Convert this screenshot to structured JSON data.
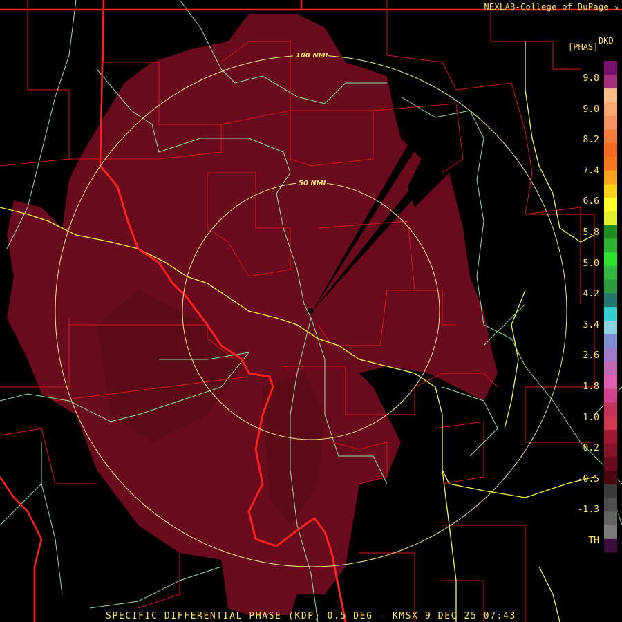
{
  "header": {
    "credit": "NEXLAB-College of DuPage",
    "credit_icon": "external-link-icon"
  },
  "legend": {
    "product_code": "DKD",
    "units": "[PHAS]",
    "labels": [
      "9.8",
      "9.0",
      "8.2",
      "7.4",
      "6.6",
      "5.8",
      "5.0",
      "4.2",
      "3.4",
      "2.6",
      "1.8",
      "1.0",
      "0.2",
      "-0.5",
      "-1.3",
      "TH"
    ],
    "colors": [
      "#7a0e6e",
      "#a52c7e",
      "#f7bd86",
      "#f9a870",
      "#f79360",
      "#f47d3a",
      "#f26b1e",
      "#f47a1c",
      "#f7a51a",
      "#f9d21a",
      "#ffff2e",
      "#e2f02a",
      "#1d8c1e",
      "#2bb42d",
      "#2ce32b",
      "#2fb93e",
      "#2a9a3a",
      "#23766c",
      "#32cfd0",
      "#8ad3df",
      "#7d8fd1",
      "#9d79c8",
      "#c068b4",
      "#e05eb0",
      "#d4418e",
      "#c3325a",
      "#d03a50",
      "#9f1a30",
      "#861225",
      "#6a0b1d",
      "#4a0710",
      "#3a3a3a",
      "#4e4e4e",
      "#636363",
      "#7a7a7a",
      "#3c0d3c"
    ]
  },
  "map": {
    "rings": [
      {
        "label": "100 NMI",
        "radius_nmi": 100
      },
      {
        "label": "50 NMI",
        "radius_nmi": 50
      }
    ],
    "radar_site": "KMSX",
    "colors": {
      "echo": "#6a0b1d",
      "echo_dark": "#5a0a17",
      "county": "#d01818",
      "state": "#ff2020",
      "river": "#8fe0a8",
      "highway": "#f5f34a",
      "ring": "#f2e58a"
    }
  },
  "footer": {
    "caption": "SPECIFIC DIFFERENTIAL PHASE (KDP) 0.5 DEG - KMSX 9 DEC 25 07:43"
  }
}
